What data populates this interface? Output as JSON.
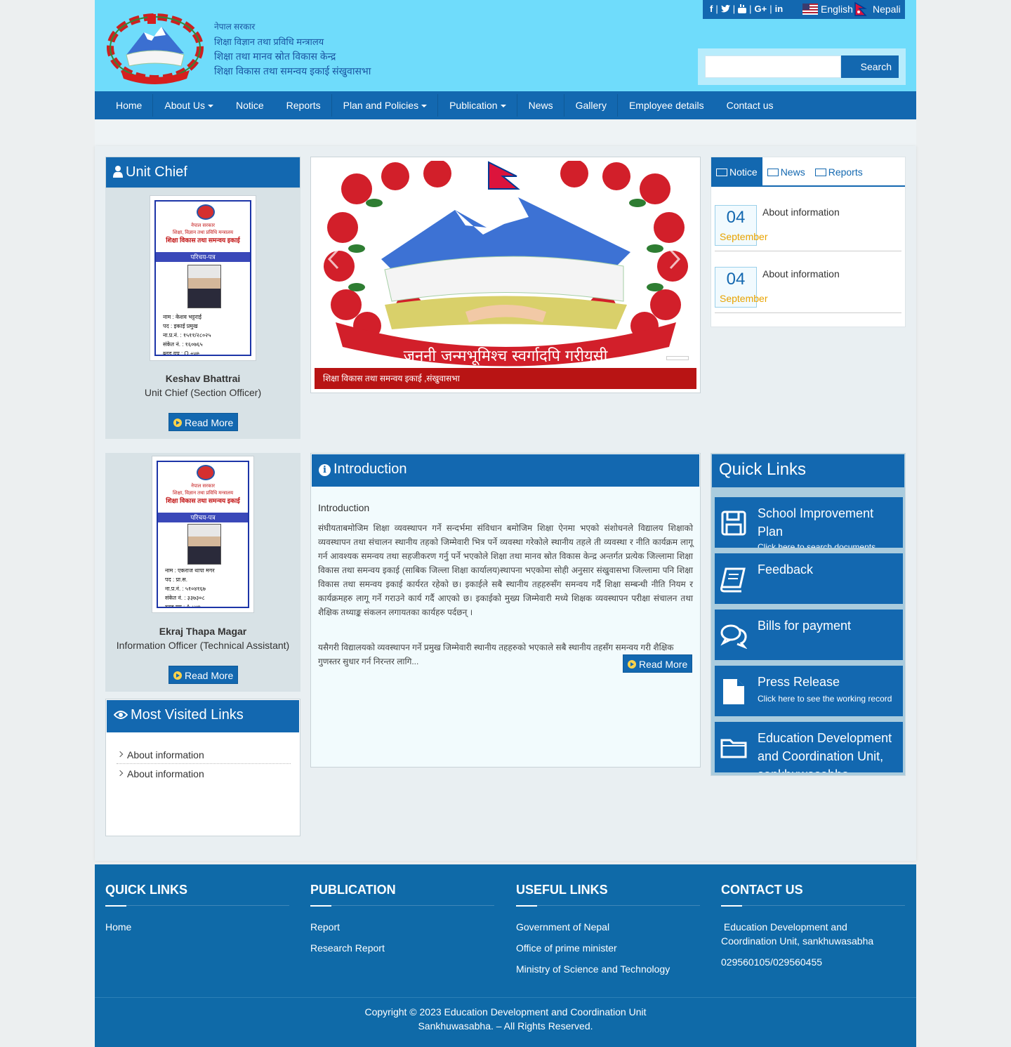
{
  "header": {
    "govt_lines": [
      "नेपाल सरकार",
      "शिक्षा विज्ञान तथा प्रविधि मन्त्रालय",
      "शिक्षा तथा मानव स्रोत विकास केन्द्र",
      "शिक्षा विकास तथा समन्वय इकाई संखुवासभा"
    ],
    "social_icons": [
      "facebook-icon",
      "twitter-icon",
      "youtube-icon",
      "google-plus-icon",
      "linkedin-icon"
    ],
    "lang_english": "English",
    "lang_nepali": "Nepali",
    "search_placeholder": "",
    "search_label": "Search"
  },
  "nav": {
    "items": [
      {
        "label": "Home"
      },
      {
        "label": "About Us"
      },
      {
        "label": "Notice"
      },
      {
        "label": "Reports"
      },
      {
        "label": "Plan and Policies"
      },
      {
        "label": "Publication"
      },
      {
        "label": "News"
      },
      {
        "label": "Gallery"
      },
      {
        "label": "Employee details"
      },
      {
        "label": "Contact us"
      }
    ]
  },
  "unit_chief": {
    "heading": "Unit Chief",
    "idcard": {
      "header": [
        "नेपाल सरकार",
        "शिक्षा, विज्ञान तथा प्रविधि मन्त्रालय",
        "शिक्षा विकास तथा समन्वय इकाई"
      ],
      "band": "परिचय-पत्र",
      "rows": [
        "नाम : केशव भट्टराई",
        "पद : इकाई प्रमुख",
        "ना.प्र.नं. : १५११/२८०२५",
        "संकेत नं. : १६०७६५",
        "ब्लड ग्रुप : O +ve"
      ]
    },
    "name": "Keshav Bhattrai",
    "title": "Unit Chief (Section Officer)",
    "read_more": "Read More"
  },
  "info_officer": {
    "idcard": {
      "header": [
        "नेपाल सरकार",
        "शिक्षा, विज्ञान तथा प्रविधि मन्त्रालय",
        "शिक्षा विकास तथा समन्वय इकाई"
      ],
      "band": "परिचय-पत्र",
      "rows": [
        "नाम : एकराज थापा मगर",
        "पद : प्रा.स.",
        "ना.प्र.नं. : ५१०४१६७",
        "संकेत नं. : ३३७३०८",
        "ब्लड ग्रुप : A +ve"
      ]
    },
    "name": "Ekraj Thapa Magar",
    "title": "Information Officer (Technical Assistant)",
    "read_more": "Read More"
  },
  "slider": {
    "caption": "शिक्षा विकास तथा समन्वय इकाई ,संखुवासभा",
    "emblem_motto": "जननी जन्मभूमिश्च स्वर्गादपि गरीयसी"
  },
  "tabs": {
    "items": [
      {
        "label": "Notice",
        "active": true
      },
      {
        "label": "News",
        "active": false
      },
      {
        "label": "Reports",
        "active": false
      }
    ],
    "notices": [
      {
        "day": "04",
        "month": "September",
        "title": "About information"
      },
      {
        "day": "04",
        "month": "September",
        "title": "About information"
      }
    ]
  },
  "intro": {
    "heading": "Introduction",
    "subheading": "Introduction",
    "paragraph1": "संघीयताबमोजिम शिक्षा व्यवस्थापन गर्ने सन्दर्भमा संविधान बमोजिम शिक्षा ऐनमा भएको संशोधनले विद्यालय शिक्षाको व्यवस्थापन तथा संचालन स्थानीय तहको जिम्मेवारी भित्र पर्ने व्यवस्था गरेकोले  स्थानीय तहले ती व्यवस्था र नीति कार्यक्रम लागू गर्न आवश्यक समन्वय तथा सहजीकरण गर्नु पर्ने भएकोले शिक्षा तथा मानव स्रोत विकास केन्द्र अन्तर्गत प्रत्येक जिल्लामा शिक्षा विकास तथा समन्वय इकाई (साबिक जिल्ला शिक्षा कार्यालय)स्थापना भएकोमा सोही अनुसार संखुवासभा जिल्लामा पनि शिक्षा विकास तथा समन्वय इकाई कार्यरत रहेको छ। इकाईले सबै स्थानीय तहहरुसँग समन्वय गर्दै शिक्षा सम्बन्धी नीति नियम र कार्यक्रमहरु लागू गर्ने गराउने कार्य गर्दै आएको छ। इकाईको मुख्य जिम्मेवारी मध्ये शिक्षक व्यवस्थापन परीक्षा संचालन तथा शैक्षिक तथ्याङ्क संकलन लगायतका कार्यहरु पर्दछन् ।",
    "paragraph2": "यसैगरी विद्यालयको व्यवस्थापन गर्ने प्रमुख जिम्मेवारी स्थानीय तहहरुको भएकाले सबै स्थानीय तहसँग समन्वय गरी शैक्षिक गुणस्तर सुधार गर्न निरन्तर लागि...",
    "read_more": "Read More"
  },
  "quick_links": {
    "heading": "Quick Links",
    "items": [
      {
        "icon": "save-icon",
        "title": "School Improvement Plan",
        "sub": "Click here to search documents"
      },
      {
        "icon": "book-icon",
        "title": "Feedback",
        "sub": ""
      },
      {
        "icon": "comments-icon",
        "title": "Bills for payment",
        "sub": ""
      },
      {
        "icon": "file-icon",
        "title": "Press Release",
        "sub": "Click here to see the working record"
      },
      {
        "icon": "folder-icon",
        "title": "Education Development and Coordination Unit, sankhuwasabha",
        "sub": ""
      }
    ]
  },
  "most_visited": {
    "heading": "Most Visited Links",
    "items": [
      "About information",
      "About information"
    ]
  },
  "footer": {
    "quick_links": {
      "heading": "QUICK LINKS",
      "items": [
        "Home"
      ]
    },
    "publication": {
      "heading": "PUBLICATION",
      "items": [
        "Report",
        "Research Report"
      ]
    },
    "useful_links": {
      "heading": "USEFUL LINKS",
      "items": [
        "Government of Nepal",
        "Office of prime minister",
        "Ministry of Science and Technology"
      ]
    },
    "contact": {
      "heading": "CONTACT US",
      "address": " Education Development and Coordination Unit, sankhuwasabha",
      "phone": "029560105/029560455"
    },
    "copyright_line1": "Copyright © 2023 Education Development and Coordination Unit",
    "copyright_line2": "Sankhuwasabha. – All Rights Reserved."
  },
  "colors": {
    "header_bg": "#6fdcfb",
    "primary": "#1368b0",
    "caption_bg": "#b81414",
    "accent_date": "#e8a300"
  }
}
